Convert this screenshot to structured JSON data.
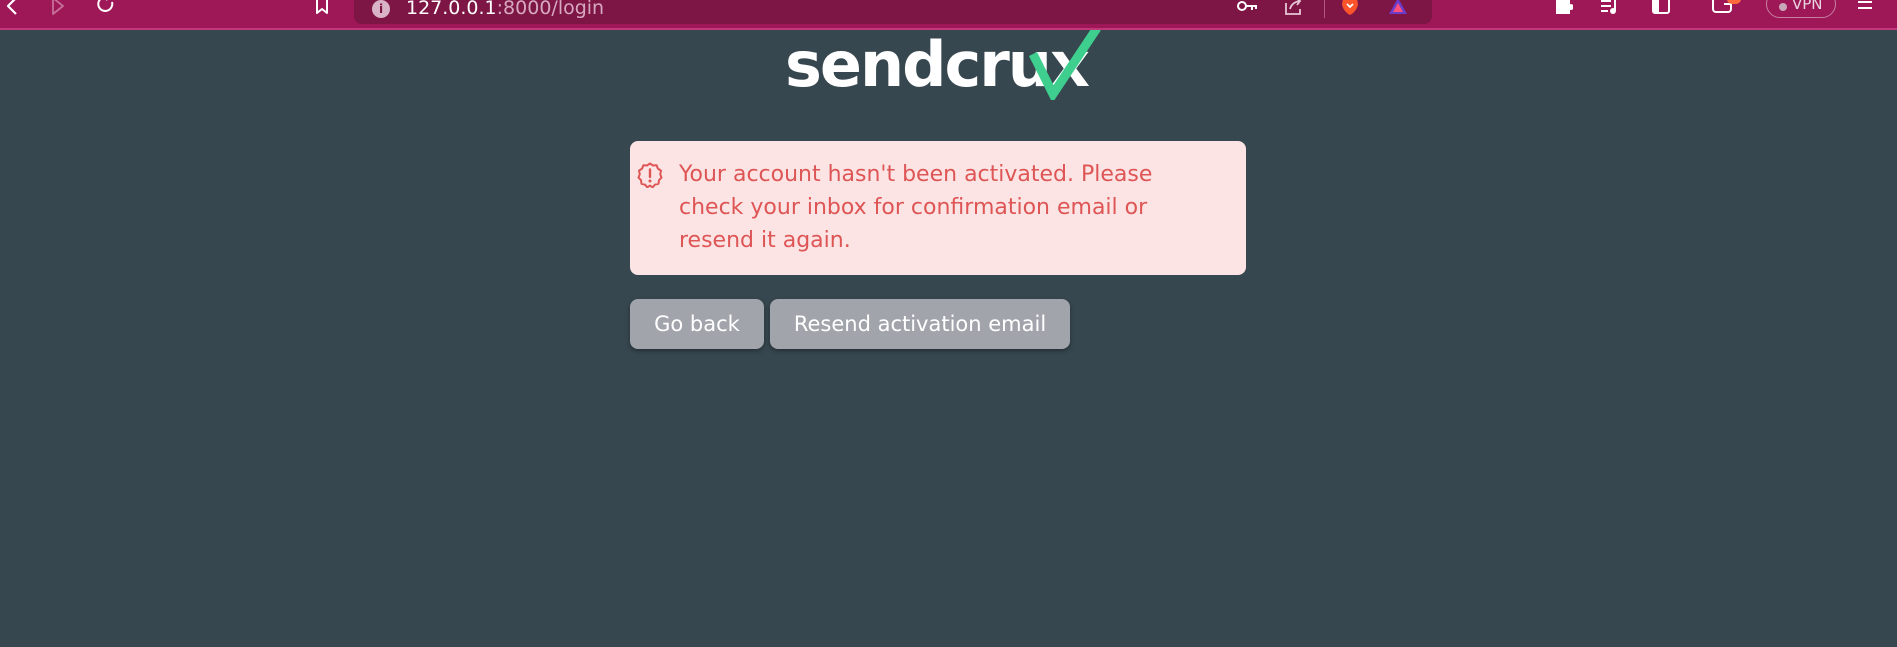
{
  "browser": {
    "address_bar": {
      "url_host": "127.0.0.1",
      "url_path": ":8000/login",
      "info_icon": "info-icon"
    },
    "vpn_label": "VPN",
    "toolbar_icons": [
      "back-icon",
      "play-icon",
      "reload-icon",
      "bookmark-icon",
      "key-icon",
      "share-icon",
      "brave-shield-icon",
      "brave-rewards-icon",
      "extensions-icon",
      "media-playlist-icon",
      "sidebar-icon",
      "wallet-icon",
      "vpn-toggle",
      "menu-icon"
    ],
    "colors": {
      "toolbar": "#9e1756",
      "address_bar": "#7d1545"
    }
  },
  "page": {
    "logo_text": "sendcrux",
    "logo_colors": {
      "text": "#ffffff",
      "checkmark": "#3ecf8e"
    },
    "background": "#37474f",
    "alert": {
      "icon": "warning-circle-icon",
      "message": "Your account hasn't been activated. Please check your inbox for confirmation email or resend it again.",
      "colors": {
        "background": "#fce4e4",
        "text": "#de5555"
      }
    },
    "buttons": {
      "go_back": "Go back",
      "resend": "Resend activation email"
    }
  }
}
